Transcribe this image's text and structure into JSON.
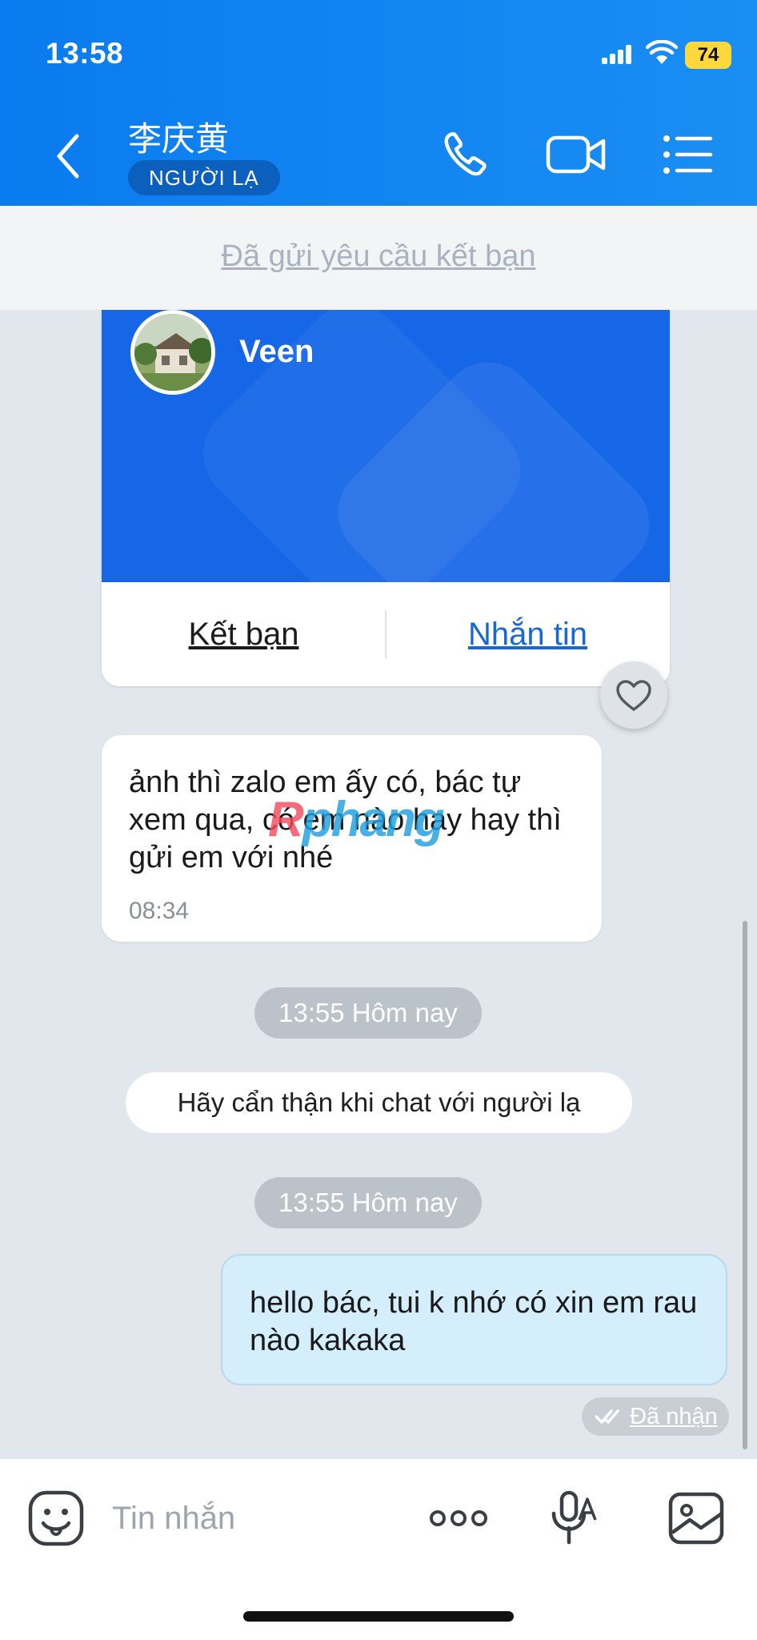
{
  "status_bar": {
    "time": "13:58",
    "battery": "74"
  },
  "header": {
    "contact_name": "李庆黄",
    "badge": "NGƯỜI LẠ"
  },
  "friend_request": {
    "text": "Đã gửi yêu cầu kết bạn"
  },
  "profile_card": {
    "name": "Veen",
    "add_friend_label": "Kết bạn",
    "message_label": "Nhắn tin",
    "cover_color": "#1667e8"
  },
  "watermark": {
    "part1": "R",
    "part2": "phang"
  },
  "messages": {
    "incoming": {
      "text": "ảnh thì zalo em ấy có, bác tự xem qua, có em nào hay hay thì gửi em với nhé",
      "time": "08:34"
    },
    "separator_1": "13:55 Hôm nay",
    "notice": "Hãy cẩn thận khi chat với người lạ",
    "separator_2": "13:55 Hôm nay",
    "outgoing": {
      "text": "hello bác, tui k nhớ có xin em rau nào kakaka",
      "status": "Đã nhận"
    }
  },
  "input": {
    "placeholder": "Tin nhắn"
  },
  "colors": {
    "header": "#0a7bf0",
    "accent_link": "#1668d9",
    "outgoing_bubble": "#d4eefc"
  }
}
